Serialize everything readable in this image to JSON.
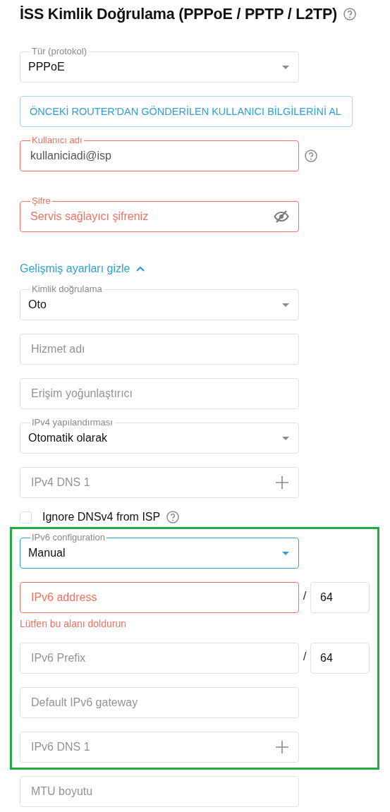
{
  "title": {
    "text": "İSS Kimlik Doğrulama (PPPoE / PPTP / L2TP)",
    "help": true
  },
  "sections": [
    {
      "items": [
        {
          "kind": "select",
          "label": "Tür (protokol)",
          "value": "PPPoE"
        },
        {
          "kind": "button",
          "text": "ÖNCEKİ ROUTER'DAN GÖNDERİLEN KULLANICI BİLGİLERİNİ AL"
        },
        {
          "kind": "input",
          "label": "Kullanıcı adı",
          "value": "kullaniciadi@isp",
          "error": true,
          "help": true
        },
        {
          "kind": "password",
          "label": "Şifre",
          "placeholder": "Servis sağlayıcı şifreniz",
          "error": true
        },
        {
          "kind": "link",
          "text": "Gelişmiş ayarları gizle",
          "expanded": true
        },
        {
          "kind": "select",
          "label": "Kimlik doğrulama",
          "value": "Oto"
        },
        {
          "kind": "input",
          "placeholder": "Hizmet adı"
        },
        {
          "kind": "input",
          "placeholder": "Erişim yoğunlaştırıcı"
        },
        {
          "kind": "select",
          "label": "IPv4 yapılandırması",
          "value": "Otomatik olarak"
        },
        {
          "kind": "dns",
          "placeholder": "IPv4 DNS 1"
        },
        {
          "kind": "checkbox",
          "text": "Ignore DNSv4 from ISP",
          "checked": false,
          "help": true
        }
      ]
    },
    {
      "highlighted": true,
      "items": [
        {
          "kind": "select",
          "label": "IPv6 configuration",
          "value": "Manual",
          "focused": true
        },
        {
          "kind": "input",
          "placeholder": "IPv6 address",
          "error": true,
          "error_text": "Lütfen bu alanı doldurun",
          "separator": "/",
          "suffix_value": "64"
        },
        {
          "kind": "input",
          "placeholder": "IPv6 Prefix",
          "separator": "/",
          "suffix_value": "64"
        },
        {
          "kind": "input",
          "placeholder": "Default IPv6 gateway"
        },
        {
          "kind": "dns",
          "placeholder": "IPv6 DNS 1"
        }
      ]
    },
    {
      "items": [
        {
          "kind": "input",
          "placeholder": "MTU boyutu"
        }
      ]
    }
  ]
}
